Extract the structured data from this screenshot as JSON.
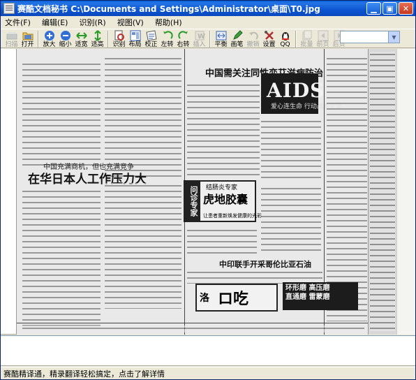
{
  "window": {
    "app_name": "赛酷文档秘书",
    "file_path": "C:\\Documents and Settings\\Administrator\\桌面\\T0.jpg"
  },
  "menu": {
    "items": [
      "文件(F)",
      "编辑(E)",
      "识别(R)",
      "视图(V)",
      "帮助(H)"
    ]
  },
  "toolbar": {
    "buttons": [
      {
        "label": "扫描",
        "icon": "scanner-icon",
        "enabled": false
      },
      {
        "label": "打开",
        "icon": "open-folder-icon",
        "enabled": true
      },
      {
        "label": "放大",
        "icon": "zoom-in-icon",
        "enabled": true
      },
      {
        "label": "缩小",
        "icon": "zoom-out-icon",
        "enabled": true
      },
      {
        "label": "适宽",
        "icon": "fit-width-icon",
        "enabled": true
      },
      {
        "label": "适高",
        "icon": "fit-height-icon",
        "enabled": true
      },
      {
        "label": "识别",
        "icon": "recognize-icon",
        "enabled": true
      },
      {
        "label": "布局",
        "icon": "layout-icon",
        "enabled": true
      },
      {
        "label": "校正",
        "icon": "deskew-icon",
        "enabled": true
      },
      {
        "label": "左转",
        "icon": "rotate-left-icon",
        "enabled": true
      },
      {
        "label": "右转",
        "icon": "rotate-right-icon",
        "enabled": true
      },
      {
        "label": "插入",
        "icon": "insert-icon",
        "enabled": false
      },
      {
        "label": "平衡",
        "icon": "balance-icon",
        "enabled": true
      },
      {
        "label": "画笔",
        "icon": "pen-icon",
        "enabled": true
      },
      {
        "label": "撤销",
        "icon": "undo-icon",
        "enabled": false
      },
      {
        "label": "设置",
        "icon": "settings-tools-icon",
        "enabled": true
      },
      {
        "label": "QQ",
        "icon": "qq-penguin-icon",
        "enabled": true
      },
      {
        "label": "批量",
        "icon": "batch-icon",
        "enabled": false
      },
      {
        "label": "前页",
        "icon": "prev-page-icon",
        "enabled": false
      },
      {
        "label": "后页",
        "icon": "next-page-icon",
        "enabled": false
      }
    ],
    "page_combo_value": ""
  },
  "scan": {
    "headline_main": "在华日本人工作压力大",
    "headline_sub": "中国充满商机，但也充满竞争",
    "headline_right": "中国需关注同性恋艾滋病防治",
    "headline_oil": "中印联手开采哥伦比亚石油",
    "aids_title": "AIDS",
    "aids_sub": "爱心连生命 行动战胜艾滋",
    "ad_top": "结肠炎专家",
    "ad_main": "虎地胶囊",
    "ad_left": "问诊专家",
    "ad_bottom": "让患者重新焕发健康的光彩",
    "ad2_line1": "环形磨 高压磨",
    "ad2_line2": "直通磨 雷蒙磨",
    "ad3_left": "洛",
    "ad3_main": "ロ吃"
  },
  "status": {
    "text": "赛酷精译通，精录翻译轻松搞定，点击了解详情"
  }
}
